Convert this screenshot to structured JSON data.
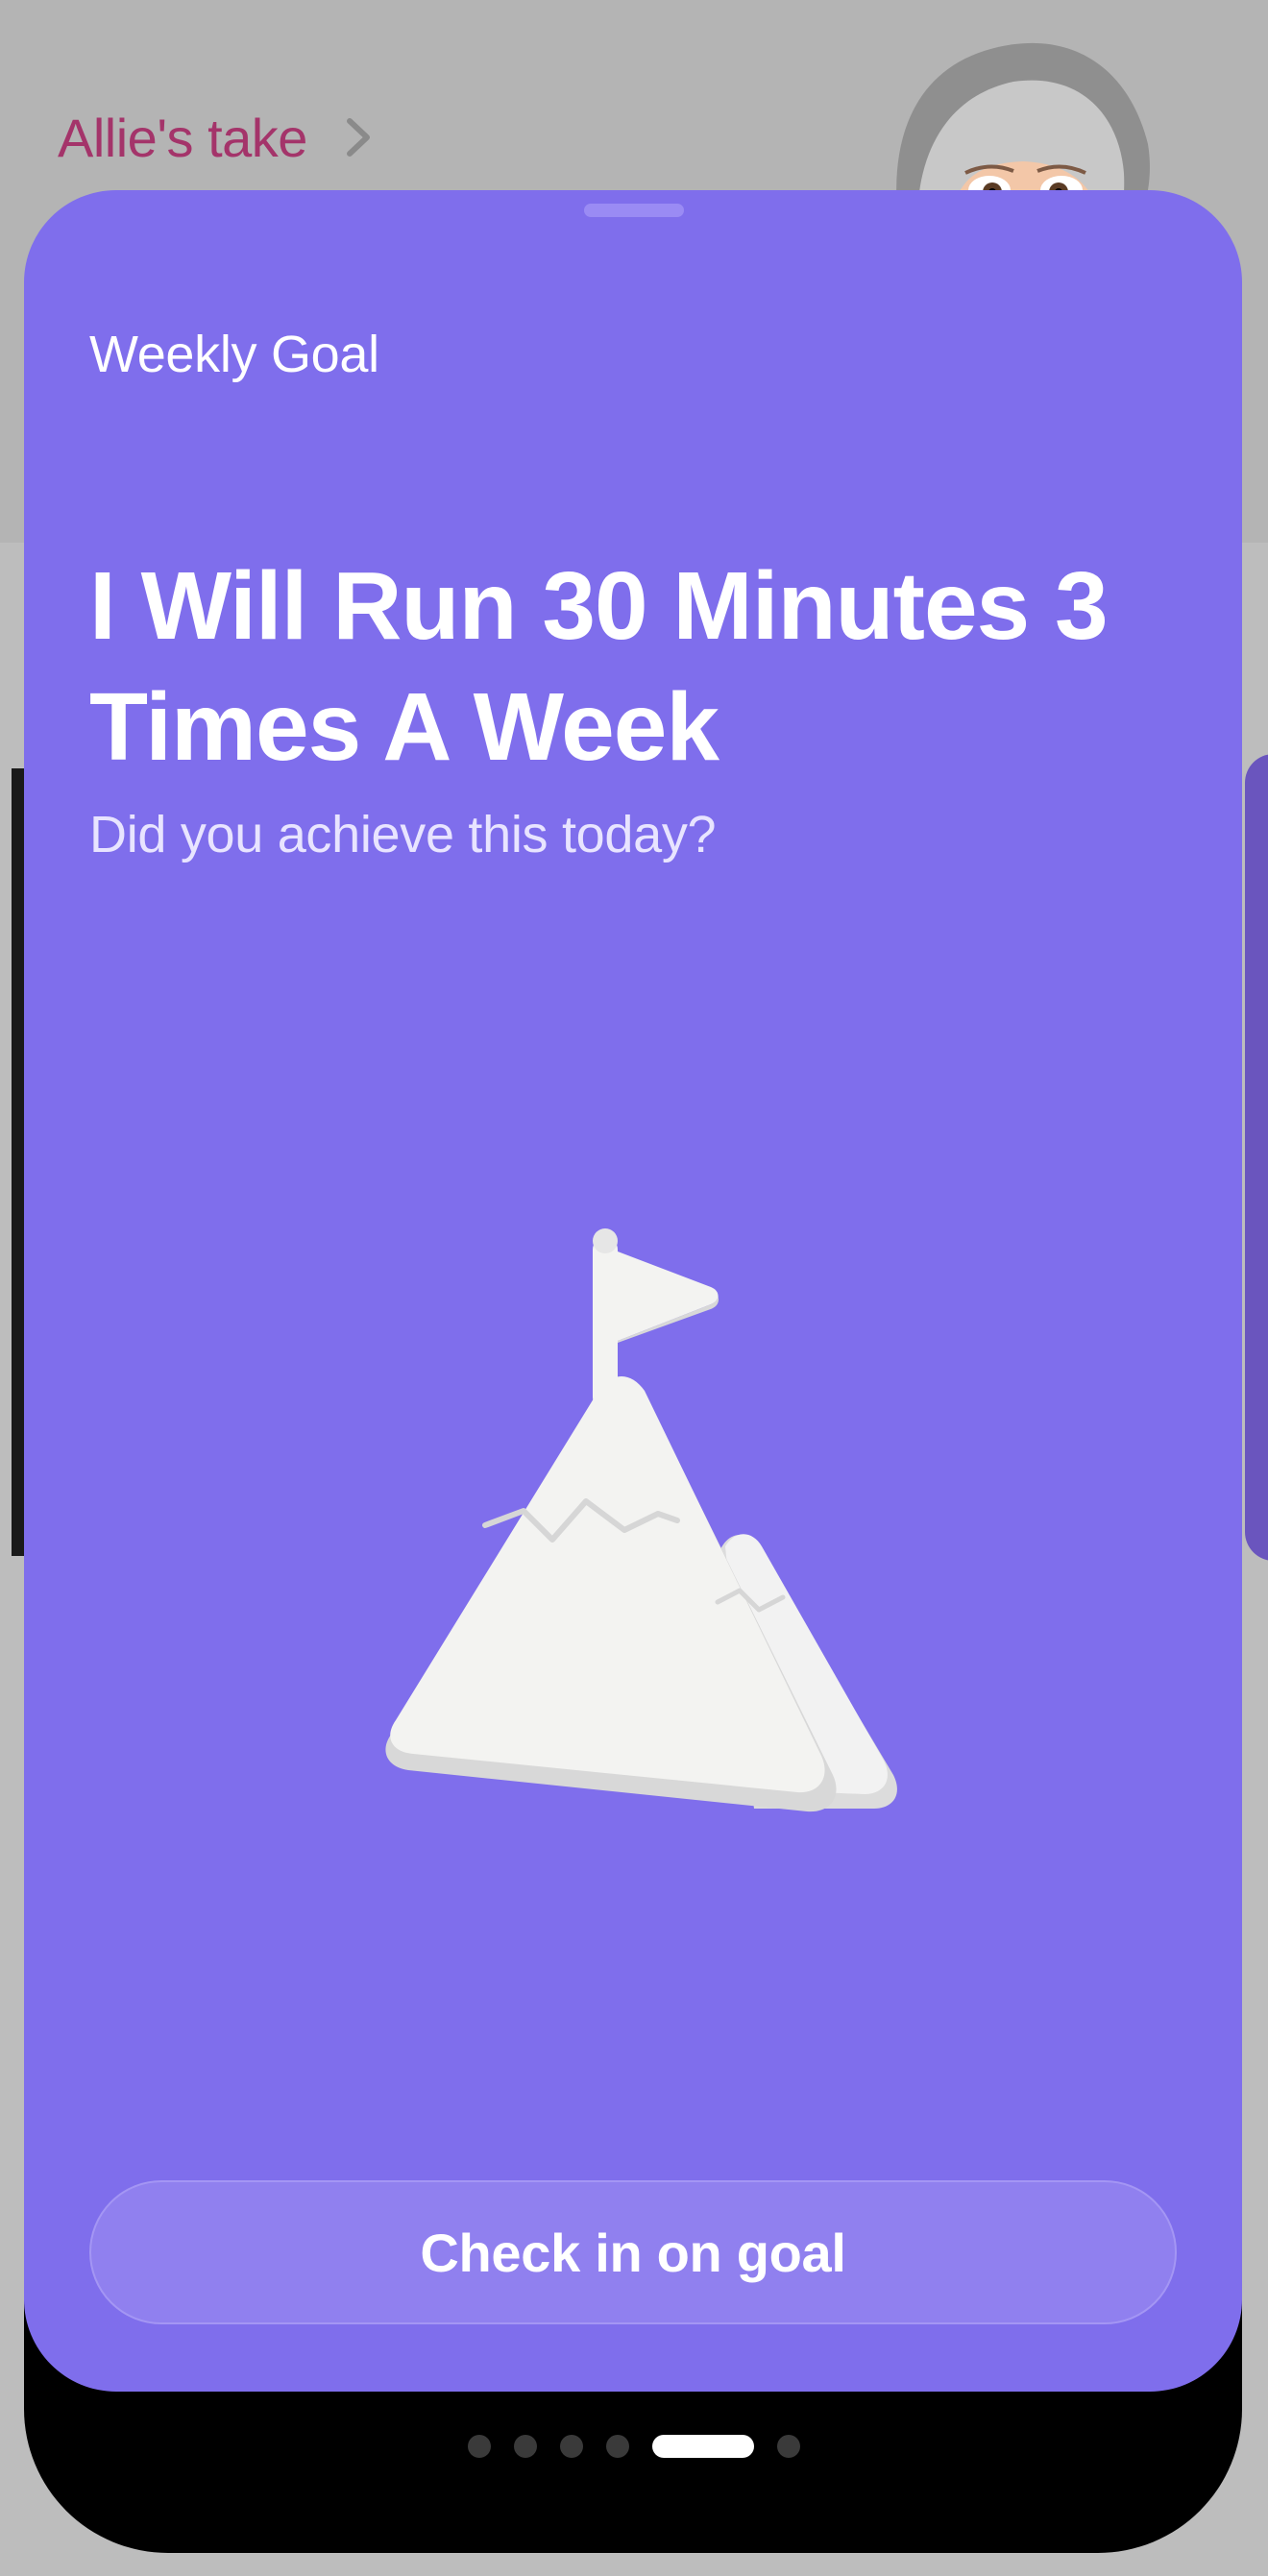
{
  "header": {
    "link_label": "Allie's take",
    "chevron_icon": "chevron-right-icon",
    "avatar_icon": "avatar-illustration"
  },
  "card": {
    "background": "#7f6eec",
    "label": "Weekly Goal",
    "title": "I Will Run 30 Minutes 3 Times A Week",
    "subtitle": "Did you achieve this today?",
    "illustration_icon": "mountain-flag-icon",
    "cta_label": "Check in on goal"
  },
  "pagination": {
    "total": 6,
    "active_index": 4
  },
  "colors": {
    "accent": "#7f6eec",
    "link": "#a4346a"
  }
}
